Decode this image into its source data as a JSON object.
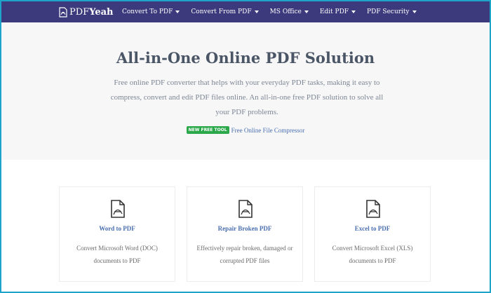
{
  "nav": {
    "logo_prefix": "PDF",
    "logo_suffix": "Yeah",
    "items": [
      {
        "label": "Convert To PDF"
      },
      {
        "label": "Convert From PDF"
      },
      {
        "label": "MS Office"
      },
      {
        "label": "Edit PDF"
      },
      {
        "label": "PDF Security"
      }
    ]
  },
  "hero": {
    "title": "All-in-One Online PDF Solution",
    "description": "Free online PDF converter that helps with your everyday PDF tasks, making it easy to compress, convert and edit PDF files online. An all-in-one free PDF solution to solve all your PDF problems.",
    "badge": "NEW FREE TOOL",
    "promo_link": "Free Online File Compressor"
  },
  "cards": [
    {
      "title": "Word to PDF",
      "desc": "Convert Microsoft Word (DOC) documents to PDF",
      "icon": "pdf-file-icon"
    },
    {
      "title": "Repair Broken PDF",
      "desc": "Effectively repair broken, damaged or corrupted PDF files",
      "icon": "pdf-file-icon"
    },
    {
      "title": "Excel to PDF",
      "desc": "Convert Microsoft Excel (XLS) documents to PDF",
      "icon": "pdf-file-icon"
    }
  ],
  "colors": {
    "navbar": "#3c3a7c",
    "link": "#4a6fb0",
    "badge": "#2aa84a",
    "frame": "#1ea3c9"
  }
}
